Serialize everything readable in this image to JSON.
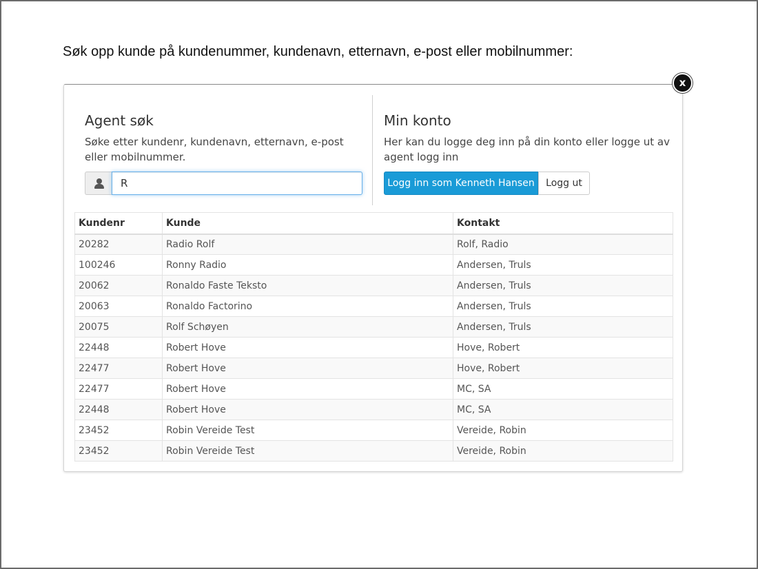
{
  "instruction": "Søk opp kunde på kundenummer, kundenavn, etternavn, e-post eller mobilnummer:",
  "close_label": "x",
  "agent_search": {
    "title": "Agent søk",
    "description": "Søke etter kundenr, kundenavn, etternavn, e-post eller mobilnummer.",
    "input_value": "R",
    "icon": "user-icon"
  },
  "my_account": {
    "title": "Min konto",
    "description": "Her kan du logge deg inn på din konto eller logge ut av agent logg inn",
    "login_label": "Logg inn som Kenneth Hansen",
    "logout_label": "Logg ut",
    "accent_color": "#1a9bd7"
  },
  "table": {
    "headers": [
      "Kundenr",
      "Kunde",
      "Kontakt"
    ],
    "rows": [
      [
        "20282",
        "Radio Rolf",
        "Rolf, Radio"
      ],
      [
        "100246",
        "Ronny Radio",
        "Andersen, Truls"
      ],
      [
        "20062",
        "Ronaldo Faste Teksto",
        "Andersen, Truls"
      ],
      [
        "20063",
        "Ronaldo Factorino",
        "Andersen, Truls"
      ],
      [
        "20075",
        "Rolf Schøyen",
        "Andersen, Truls"
      ],
      [
        "22448",
        "Robert Hove",
        "Hove, Robert"
      ],
      [
        "22477",
        "Robert Hove",
        "Hove, Robert"
      ],
      [
        "22477",
        "Robert Hove",
        "MC, SA"
      ],
      [
        "22448",
        "Robert Hove",
        "MC, SA"
      ],
      [
        "23452",
        "Robin Vereide Test",
        "Vereide, Robin"
      ],
      [
        "23452",
        "Robin Vereide Test",
        "Vereide, Robin"
      ]
    ]
  }
}
